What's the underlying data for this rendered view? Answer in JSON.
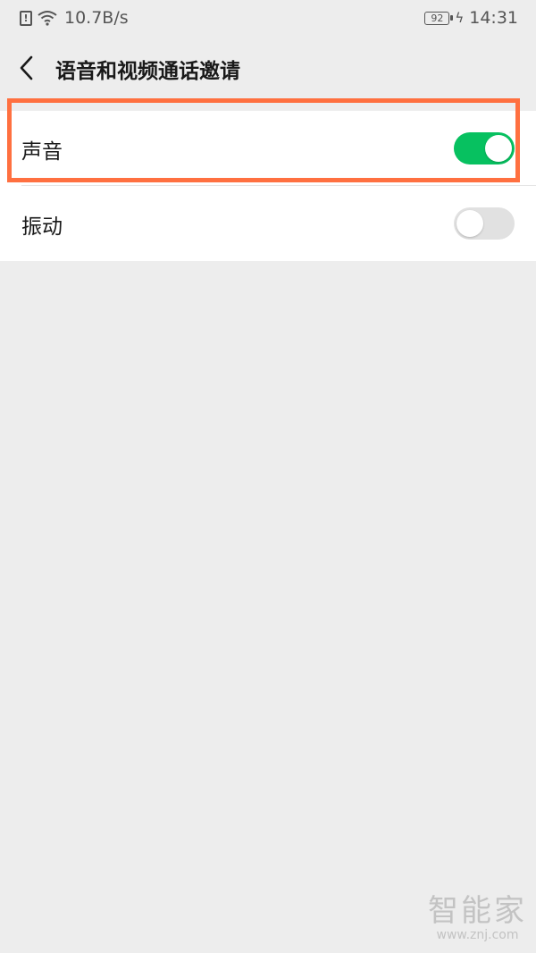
{
  "status_bar": {
    "network_speed": "10.7B/s",
    "battery_level": "92",
    "time": "14:31",
    "icons": [
      "alert-icon",
      "wifi-icon",
      "battery-icon",
      "charging-bolt-icon"
    ]
  },
  "nav": {
    "title": "语音和视频通话邀请",
    "back_icon": "chevron-left-icon"
  },
  "settings": {
    "items": [
      {
        "label": "声音",
        "enabled": true
      },
      {
        "label": "振动",
        "enabled": false
      }
    ]
  },
  "colors": {
    "toggle_on": "#07c160",
    "toggle_off": "#e1e1e1",
    "highlight": "#ff7040",
    "background": "#ededed"
  },
  "watermark": {
    "brand": "智能家",
    "url": "www.znj.com"
  }
}
